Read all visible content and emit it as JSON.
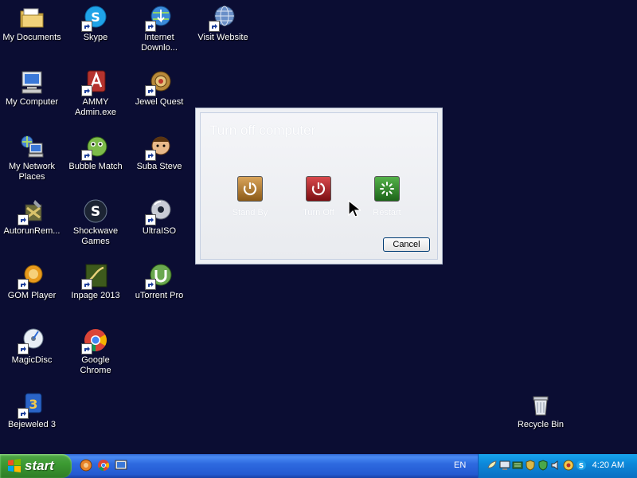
{
  "desktop": {
    "icons": [
      {
        "label": "My Documents",
        "icon": "folder-documents-icon"
      },
      {
        "label": "Skype",
        "icon": "skype-icon"
      },
      {
        "label": "Internet Downlo...",
        "icon": "internet-download-manager-icon"
      },
      {
        "label": "Visit Website",
        "icon": "globe-icon"
      },
      {
        "label": "My Computer",
        "icon": "computer-icon"
      },
      {
        "label": "AMMY Admin.exe",
        "icon": "ammy-admin-icon"
      },
      {
        "label": "Jewel Quest",
        "icon": "jewel-quest-icon"
      },
      {
        "label": "My Network Places",
        "icon": "network-places-icon"
      },
      {
        "label": "Bubble Match",
        "icon": "bubble-match-icon"
      },
      {
        "label": "Suba Steve",
        "icon": "suba-steve-icon"
      },
      {
        "label": "AutorunRem...",
        "icon": "autorun-remover-icon"
      },
      {
        "label": "Shockwave Games",
        "icon": "shockwave-icon"
      },
      {
        "label": "UltraISO",
        "icon": "disc-icon"
      },
      {
        "label": "GOM Player",
        "icon": "gom-player-icon"
      },
      {
        "label": "Inpage 2013",
        "icon": "inpage-icon"
      },
      {
        "label": "uTorrent Pro",
        "icon": "utorrent-icon"
      },
      {
        "label": "MagicDisc",
        "icon": "magicdisc-icon"
      },
      {
        "label": "Google Chrome",
        "icon": "chrome-icon"
      },
      {
        "label": "Bejeweled 3",
        "icon": "bejeweled-icon"
      },
      {
        "label": "Recycle Bin",
        "icon": "recycle-bin-icon"
      }
    ]
  },
  "dialog": {
    "title": "Turn off computer",
    "buttons": {
      "standby": "Stand By",
      "turnoff": "Turn Off",
      "restart": "Restart"
    },
    "cancel": "Cancel"
  },
  "taskbar": {
    "start": "start",
    "language": "EN",
    "clock": "4:20 AM"
  },
  "colors": {
    "desktop_bg": "#0b0d33",
    "taskbar_blue": "#245edb",
    "start_green": "#3c9a32",
    "tray_blue": "#0c88da"
  }
}
